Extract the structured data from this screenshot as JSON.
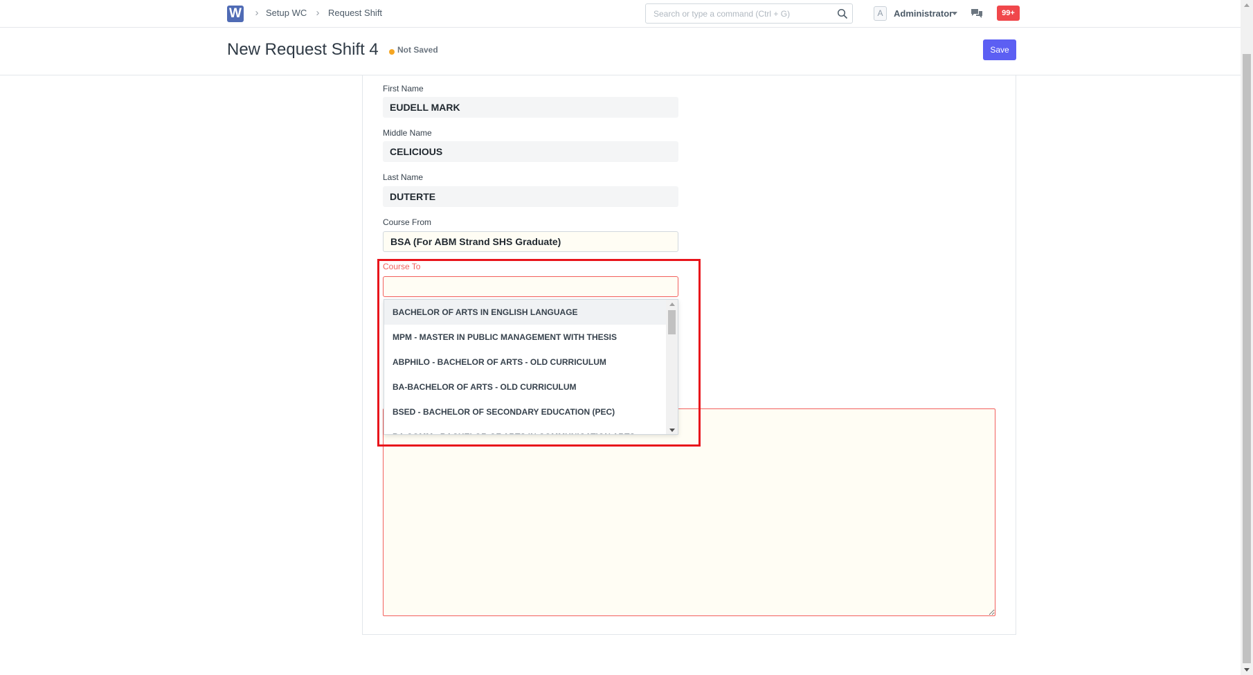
{
  "navbar": {
    "logo_letter": "W",
    "breadcrumbs": [
      "Setup WC",
      "Request Shift"
    ],
    "search_placeholder": "Search or type a command (Ctrl + G)",
    "avatar_letter": "A",
    "user_name": "Administrator",
    "notification_count": "99+",
    "brand_color": "#4f6bb5",
    "badge_color": "#f0474b"
  },
  "page": {
    "title": "New Request Shift 4",
    "status": "Not Saved",
    "status_color": "#f5a623",
    "save_label": "Save",
    "save_color": "#5c5ff3"
  },
  "form": {
    "first_name": {
      "label": "First Name",
      "value": "EUDELL MARK"
    },
    "middle_name": {
      "label": "Middle Name",
      "value": "CELICIOUS"
    },
    "last_name": {
      "label": "Last Name",
      "value": "DUTERTE"
    },
    "course_from": {
      "label": "Course From",
      "value": "BSA (For ABM Strand SHS Graduate)"
    },
    "course_to": {
      "label": "Course To",
      "value": "",
      "error_color": "#f25f5c",
      "options": [
        "BACHELOR OF ARTS IN ENGLISH LANGUAGE",
        "MPM - MASTER IN PUBLIC MANAGEMENT WITH THESIS",
        "ABPHILO - BACHELOR OF ARTS - OLD CURRICULUM",
        "BA-BACHELOR OF ARTS - OLD CURRICULUM",
        "BSED - BACHELOR OF SECONDARY EDUCATION (PEC)",
        "BA COMM - BACHELOR OF ARTS IN COMMUNICATION ARTS"
      ]
    }
  }
}
